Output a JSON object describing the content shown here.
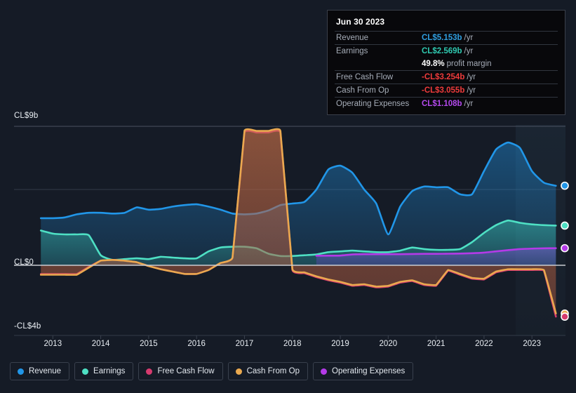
{
  "axis": {
    "y_top_label": "CL$9b",
    "y_zero_label": "CL$0",
    "y_bottom_label": "-CL$4b",
    "x_labels": [
      "2013",
      "2014",
      "2015",
      "2016",
      "2017",
      "2018",
      "2019",
      "2020",
      "2021",
      "2022",
      "2023"
    ]
  },
  "tooltip": {
    "date": "Jun 30 2023",
    "rows": [
      {
        "name": "Revenue",
        "value": "CL$5.153b",
        "unit": "/yr",
        "color": "#2f9fe0"
      },
      {
        "name": "Earnings",
        "value": "CL$2.569b",
        "unit": "/yr",
        "color": "#2fc9b0"
      },
      {
        "name": "",
        "value": "49.8%",
        "unit": "profit margin",
        "color": "#ffffff"
      },
      {
        "name": "Free Cash Flow",
        "value": "-CL$3.254b",
        "unit": "/yr",
        "color": "#ef3b3b"
      },
      {
        "name": "Cash From Op",
        "value": "-CL$3.055b",
        "unit": "/yr",
        "color": "#ef3b3b"
      },
      {
        "name": "Operating Expenses",
        "value": "CL$1.108b",
        "unit": "/yr",
        "color": "#b44aee"
      }
    ]
  },
  "legend": [
    {
      "label": "Revenue",
      "color": "#2196e8"
    },
    {
      "label": "Earnings",
      "color": "#4ee0c4"
    },
    {
      "label": "Free Cash Flow",
      "color": "#d63a6e"
    },
    {
      "label": "Cash From Op",
      "color": "#eaa94f"
    },
    {
      "label": "Operating Expenses",
      "color": "#b43ae8"
    }
  ],
  "chart_data": {
    "type": "area",
    "title": "",
    "xlabel": "",
    "ylabel": "",
    "currency": "CL$",
    "units": "billions per year",
    "ylim": [
      -4,
      9
    ],
    "xlim": [
      2012.6,
      2023.7
    ],
    "grid": true,
    "gridlines_y": [
      9,
      4.5,
      0
    ],
    "legend_position": "bottom-left",
    "annotations": [
      "forecast band begins 2022.4"
    ],
    "x": [
      2012.75,
      2013.0,
      2013.25,
      2013.5,
      2013.75,
      2014.0,
      2014.25,
      2014.5,
      2014.75,
      2015.0,
      2015.25,
      2015.5,
      2015.75,
      2016.0,
      2016.25,
      2016.5,
      2016.75,
      2017.0,
      2017.25,
      2017.5,
      2017.75,
      2018.0,
      2018.25,
      2018.5,
      2018.75,
      2019.0,
      2019.25,
      2019.5,
      2019.75,
      2020.0,
      2020.25,
      2020.5,
      2020.75,
      2021.0,
      2021.25,
      2021.5,
      2021.75,
      2022.0,
      2022.25,
      2022.5,
      2022.75,
      2023.0,
      2023.25,
      2023.5
    ],
    "series": [
      {
        "name": "Revenue",
        "color": "#2196e8",
        "values": [
          3.05,
          3.05,
          3.1,
          3.3,
          3.4,
          3.4,
          3.35,
          3.4,
          3.75,
          3.6,
          3.65,
          3.8,
          3.9,
          3.95,
          3.8,
          3.6,
          3.35,
          3.3,
          3.35,
          3.55,
          3.9,
          4.0,
          4.1,
          4.9,
          6.2,
          6.45,
          6.0,
          4.9,
          4.0,
          2.0,
          3.8,
          4.8,
          5.1,
          5.05,
          5.05,
          4.6,
          4.6,
          6.1,
          7.5,
          7.95,
          7.6,
          6.1,
          5.35,
          5.15
        ]
      },
      {
        "name": "Earnings",
        "color": "#4ee0c4",
        "values": [
          2.25,
          2.05,
          2.0,
          2.0,
          1.95,
          0.65,
          0.35,
          0.4,
          0.45,
          0.4,
          0.55,
          0.5,
          0.45,
          0.45,
          0.9,
          1.15,
          1.2,
          1.2,
          1.1,
          0.75,
          0.6,
          0.6,
          0.65,
          0.7,
          0.85,
          0.9,
          0.95,
          0.9,
          0.85,
          0.85,
          0.95,
          1.15,
          1.05,
          1.0,
          1.0,
          1.05,
          1.5,
          2.1,
          2.6,
          2.9,
          2.75,
          2.65,
          2.6,
          2.57
        ]
      },
      {
        "name": "Free Cash Flow",
        "color": "#d63a6e",
        "values": [
          -0.55,
          -0.55,
          -0.55,
          -0.55,
          -0.1,
          0.3,
          0.35,
          0.3,
          0.2,
          -0.05,
          -0.25,
          -0.4,
          -0.55,
          -0.55,
          -0.3,
          0.15,
          0.5,
          8.6,
          8.6,
          8.6,
          8.6,
          -0.3,
          -0.5,
          -0.75,
          -0.95,
          -1.1,
          -1.3,
          -1.25,
          -1.4,
          -1.35,
          -1.1,
          -1.0,
          -1.25,
          -1.3,
          -0.35,
          -0.6,
          -0.85,
          -0.9,
          -0.45,
          -0.3,
          -0.3,
          -0.3,
          -0.35,
          -3.25
        ]
      },
      {
        "name": "Cash From Op",
        "color": "#eaa94f",
        "values": [
          -0.6,
          -0.6,
          -0.6,
          -0.6,
          -0.15,
          0.3,
          0.35,
          0.3,
          0.2,
          -0.05,
          -0.25,
          -0.4,
          -0.55,
          -0.55,
          -0.3,
          0.15,
          0.5,
          8.7,
          8.7,
          8.7,
          8.7,
          -0.25,
          -0.45,
          -0.7,
          -0.9,
          -1.05,
          -1.25,
          -1.2,
          -1.35,
          -1.3,
          -1.05,
          -0.95,
          -1.2,
          -1.25,
          -0.3,
          -0.55,
          -0.8,
          -0.85,
          -0.4,
          -0.25,
          -0.25,
          -0.25,
          -0.3,
          -3.05
        ]
      },
      {
        "name": "Operating Expenses",
        "color": "#b43ae8",
        "values": [
          null,
          null,
          null,
          null,
          null,
          null,
          null,
          null,
          null,
          null,
          null,
          null,
          null,
          null,
          null,
          null,
          null,
          null,
          null,
          null,
          null,
          null,
          null,
          0.62,
          0.62,
          0.63,
          0.7,
          0.72,
          0.72,
          0.72,
          0.72,
          0.73,
          0.74,
          0.74,
          0.75,
          0.76,
          0.78,
          0.82,
          0.9,
          0.98,
          1.05,
          1.08,
          1.1,
          1.108
        ]
      }
    ],
    "end_markers": [
      {
        "series": "Revenue",
        "value": 5.153
      },
      {
        "series": "Earnings",
        "value": 2.569
      },
      {
        "series": "Operating Expenses",
        "value": 1.108
      },
      {
        "series": "Cash From Op",
        "value": -3.055
      },
      {
        "series": "Free Cash Flow",
        "value": -3.254
      }
    ]
  }
}
